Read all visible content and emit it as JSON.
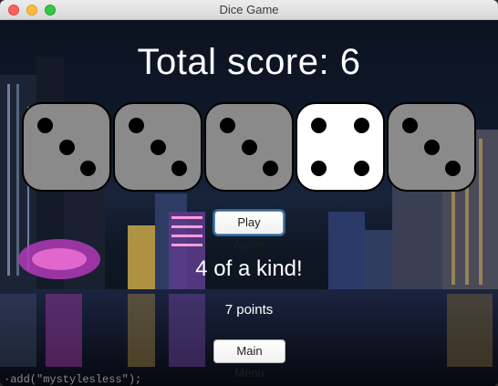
{
  "window": {
    "title": "Dice Game"
  },
  "game": {
    "score_text": "Total score: 6",
    "result_text": "4 of a kind!",
    "points_text": "7 points",
    "dice": [
      {
        "value": 3,
        "held": false
      },
      {
        "value": 3,
        "held": false
      },
      {
        "value": 3,
        "held": false
      },
      {
        "value": 4,
        "held": true
      },
      {
        "value": 3,
        "held": false
      }
    ]
  },
  "buttons": {
    "play_again": "Play Again",
    "main_menu": "Main Menu"
  },
  "background_code": "·add(\"mystylesless\");",
  "colors": {
    "die_normal": "#8a8a8a",
    "die_held": "#ffffff",
    "pip": "#000000",
    "focus_ring": "#5a9ad8"
  }
}
